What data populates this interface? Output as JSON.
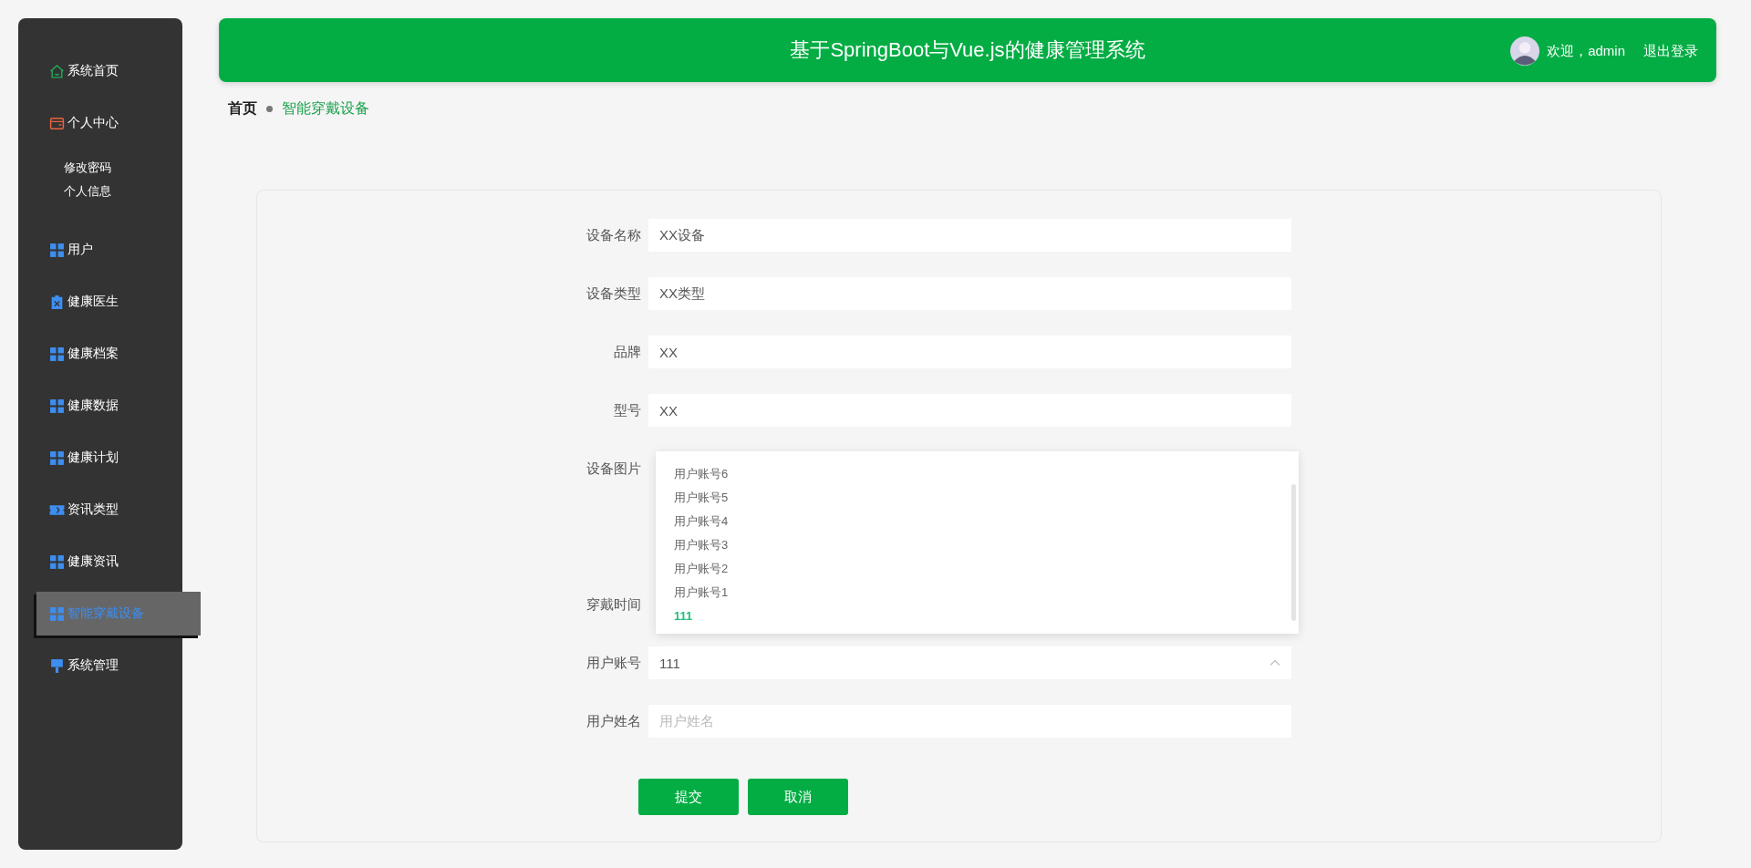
{
  "sidebar": {
    "items": [
      {
        "label": "系统首页",
        "kind": "home",
        "selected": false
      },
      {
        "label": "个人中心",
        "kind": "card",
        "selected": false,
        "children": [
          {
            "label": "修改密码",
            "selected": false
          },
          {
            "label": "个人信息",
            "selected": false
          }
        ]
      },
      {
        "label": "用户",
        "kind": "grid",
        "selected": false
      },
      {
        "label": "健康医生",
        "kind": "clipboard",
        "selected": false
      },
      {
        "label": "健康档案",
        "kind": "grid",
        "selected": false
      },
      {
        "label": "健康数据",
        "kind": "grid",
        "selected": false
      },
      {
        "label": "健康计划",
        "kind": "grid",
        "selected": false
      },
      {
        "label": "资讯类型",
        "kind": "ticket",
        "selected": false
      },
      {
        "label": "健康资讯",
        "kind": "grid",
        "selected": false
      },
      {
        "label": "智能穿戴设备",
        "kind": "grid",
        "selected": true
      },
      {
        "label": "系统管理",
        "kind": "brush",
        "selected": false
      }
    ]
  },
  "header": {
    "title": "基于SpringBoot与Vue.js的健康管理系统",
    "welcome": "欢迎，admin",
    "logout": "退出登录"
  },
  "breadcrumb": [
    {
      "label": "首页",
      "selected": false
    },
    {
      "label": "智能穿戴设备",
      "selected": true
    }
  ],
  "form": {
    "fields": [
      {
        "label": "设备名称",
        "kind": "text",
        "value": "XX设备"
      },
      {
        "label": "设备类型",
        "kind": "text",
        "value": "XX类型"
      },
      {
        "label": "品牌",
        "kind": "text",
        "value": "XX"
      },
      {
        "label": "型号",
        "kind": "text",
        "value": "XX"
      },
      {
        "label": "设备图片",
        "kind": "image"
      },
      {
        "label": "穿戴时间",
        "kind": "date"
      },
      {
        "label": "用户账号",
        "kind": "select",
        "value": "111",
        "expanded": true
      },
      {
        "label": "用户姓名",
        "kind": "text",
        "placeholder": "用户姓名"
      }
    ],
    "dropdown": {
      "options": [
        {
          "label": "用户账号6",
          "selected": false
        },
        {
          "label": "用户账号5",
          "selected": false
        },
        {
          "label": "用户账号4",
          "selected": false
        },
        {
          "label": "用户账号3",
          "selected": false
        },
        {
          "label": "用户账号2",
          "selected": false
        },
        {
          "label": "用户账号1",
          "selected": false
        },
        {
          "label": "111",
          "selected": true
        }
      ]
    },
    "buttons": [
      "提交",
      "取消"
    ]
  }
}
